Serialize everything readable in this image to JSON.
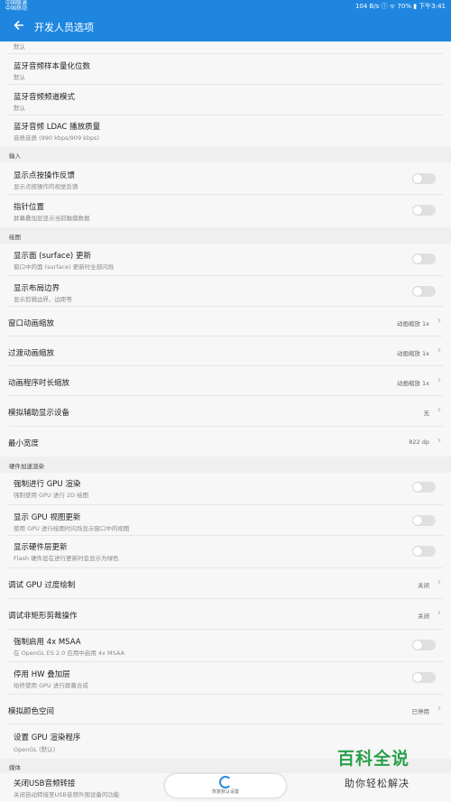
{
  "status_bar": {
    "carrier1": "中国联通",
    "carrier2": "中国移动",
    "right": "104 B/s ⓘ ᯤ 70% ▮ 下午3:41"
  },
  "header": {
    "back_icon": "arrow-back-icon",
    "title": "开发人员选项"
  },
  "items": {
    "cut_top": {
      "subtitle": "默认"
    },
    "bt_sample": {
      "title": "蓝牙音频样本量化位数",
      "subtitle": "默认"
    },
    "bt_channel": {
      "title": "蓝牙音频频道模式",
      "subtitle": "默认"
    },
    "bt_ldac": {
      "title": "蓝牙音频 LDAC 播放质量",
      "subtitle": "音质音质 (990 kbps/909 kbps)"
    },
    "show_taps": {
      "title": "显示点按操作反馈",
      "subtitle": "显示点按操作的视觉反馈"
    },
    "pointer": {
      "title": "指针位置",
      "subtitle": "屏幕叠加层显示当前触摸数据"
    },
    "surface": {
      "title": "显示面 (surface) 更新",
      "subtitle": "窗口中的面 (surface) 更新时全部闪烁"
    },
    "layout_bounds": {
      "title": "显示布局边界",
      "subtitle": "显示剪辑边界、边距等"
    },
    "window_anim": {
      "title": "窗口动画缩放",
      "value": "动画缩放 1x"
    },
    "transition_anim": {
      "title": "过渡动画缩放",
      "value": "动画缩放 1x"
    },
    "animator_duration": {
      "title": "动画程序时长缩放",
      "value": "动画缩放 1x"
    },
    "secondary_display": {
      "title": "模拟辅助显示设备",
      "value": "无"
    },
    "min_width": {
      "title": "最小宽度",
      "value": "822 dp"
    },
    "force_gpu": {
      "title": "强制进行 GPU 渲染",
      "subtitle": "强制使用 GPU 进行 2D 绘图"
    },
    "gpu_view": {
      "title": "显示 GPU 视图更新",
      "subtitle": "使用 GPU 进行绘图时闪烁显示窗口中的视图"
    },
    "hw_layers": {
      "title": "显示硬件层更新",
      "subtitle": "Flash 硬件层在进行更新时会显示为绿色"
    },
    "gpu_overdraw": {
      "title": "调试 GPU 过度绘制",
      "value": "关闭"
    },
    "non_rect_clip": {
      "title": "调试非矩形剪裁操作",
      "value": "关闭"
    },
    "msaa": {
      "title": "强制启用 4x MSAA",
      "subtitle": "在 OpenGL ES 2.0 应用中启用 4x MSAA"
    },
    "disable_hw_overlay": {
      "title": "停用 HW 叠加层",
      "subtitle": "始终使用 GPU 进行屏幕合成"
    },
    "color_space": {
      "title": "模拟颜色空间",
      "value": "已停用"
    },
    "gpu_renderer": {
      "title": "设置 GPU 渲染程序",
      "subtitle": "OpenGL (默认)"
    },
    "usb_audio": {
      "title": "关闭USB音频转接",
      "subtitle": "关闭自动转接至USB音频外围设备的功能"
    }
  },
  "sections": {
    "input": "输入",
    "drawing": "绘图",
    "hw_accel": "硬件加速渲染",
    "media": "媒体"
  },
  "footer": {
    "restore_label": "恢复默认设置"
  },
  "watermark": {
    "top": "百科全说",
    "bottom": "助你轻松解决"
  },
  "colors": {
    "accent": "#1e86df",
    "watermark_green": "#2aa04a"
  }
}
